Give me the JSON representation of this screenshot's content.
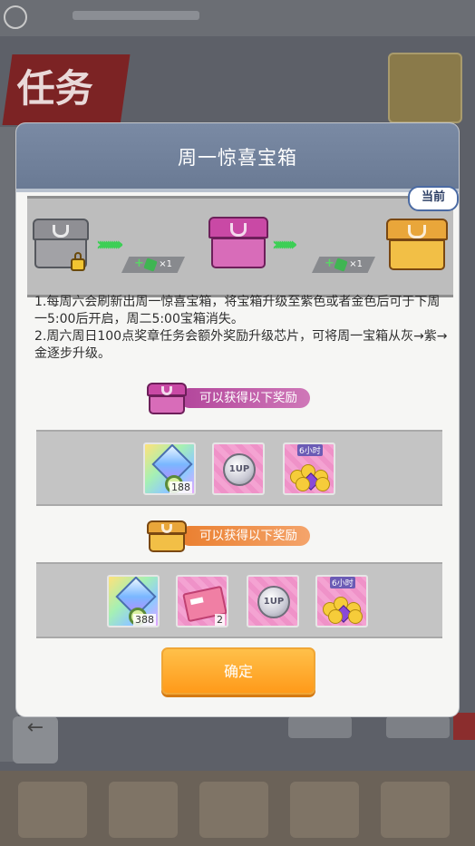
{
  "background": {
    "ribbon_text": "任务",
    "back_icon": "back-arrow-icon"
  },
  "dialog": {
    "title": "周一惊喜宝箱",
    "current_badge": "当前",
    "progress": {
      "chests": [
        "grey-chest-icon",
        "purple-chest-icon",
        "gold-chest-icon"
      ],
      "upgrade_cost": [
        "×1",
        "×1"
      ]
    },
    "description": [
      "1.每周六会刷新出周一惊喜宝箱，将宝箱升级至紫色或者金色后可于下周一5:00后开启，周二5:00宝箱消失。",
      "2.周六周日100点奖章任务会额外奖励升级芯片，可将周一宝箱从灰→紫→金逐步升级。"
    ],
    "purple_rewards": {
      "header": "可以获得以下奖励",
      "items": [
        {
          "icon": "crystal-gem-icon",
          "qty": "188"
        },
        {
          "icon": "1up-coin-icon",
          "qty": ""
        },
        {
          "icon": "gold-pile-icon",
          "tag": "6小时",
          "qty": ""
        }
      ]
    },
    "gold_rewards": {
      "header": "可以获得以下奖励",
      "items": [
        {
          "icon": "crystal-gem-icon",
          "qty": "388"
        },
        {
          "icon": "ticket-icon",
          "qty": "2"
        },
        {
          "icon": "1up-coin-icon",
          "qty": ""
        },
        {
          "icon": "gold-pile-icon",
          "tag": "6小时",
          "qty": ""
        }
      ]
    },
    "confirm_label": "确定"
  },
  "colors": {
    "header": "#7485a0",
    "purple_pill": "#b2459b",
    "orange_pill": "#ea7f2f",
    "confirm": "#ffa726",
    "arrow_green": "#3ccf55"
  }
}
